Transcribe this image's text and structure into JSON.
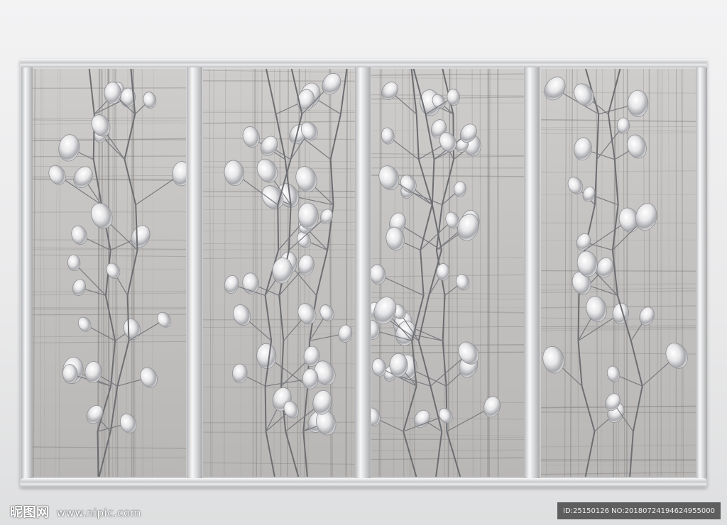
{
  "image": {
    "description_colors": {
      "frame": "#c9cacc",
      "panel_background": "#c3c1bf",
      "crystal_highlight": "#ffffff",
      "branch": "#6d6e72"
    },
    "panel_count": 4
  },
  "watermark": {
    "brand": "昵图网",
    "url": "www.nipic.com"
  },
  "id_strip": {
    "text": "ID:25150126 NO:20180724194624955000"
  }
}
